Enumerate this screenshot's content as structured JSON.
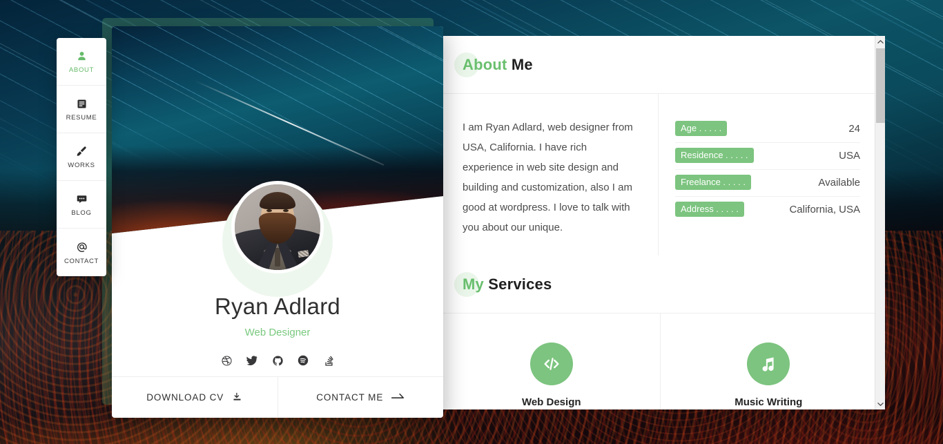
{
  "sidebar": {
    "items": [
      {
        "label": "ABOUT",
        "icon": "person-icon",
        "active": true
      },
      {
        "label": "RESUME",
        "icon": "document-icon",
        "active": false
      },
      {
        "label": "WORKS",
        "icon": "brush-icon",
        "active": false
      },
      {
        "label": "BLOG",
        "icon": "comment-icon",
        "active": false
      },
      {
        "label": "CONTACT",
        "icon": "at-icon",
        "active": false
      }
    ]
  },
  "profile": {
    "name": "Ryan Adlard",
    "role": "Web Designer",
    "socials": [
      {
        "name": "dribbble-icon"
      },
      {
        "name": "twitter-icon"
      },
      {
        "name": "github-icon"
      },
      {
        "name": "spotify-icon"
      },
      {
        "name": "stack-overflow-icon"
      }
    ],
    "actions": [
      {
        "label": "DOWNLOAD CV",
        "icon": "download-icon"
      },
      {
        "label": "CONTACT ME",
        "icon": "arrow-right-icon"
      }
    ]
  },
  "about": {
    "heading_accent": "About",
    "heading_rest": " Me",
    "text": "I am Ryan Adlard, web designer from USA, California. I have rich experience in web site design and building and customization, also I am good at wordpress. I love to talk with you about our unique.",
    "info": [
      {
        "key": "Age . . . . .",
        "value": "24"
      },
      {
        "key": "Residence . . . . .",
        "value": "USA"
      },
      {
        "key": "Freelance . . . . .",
        "value": "Available"
      },
      {
        "key": "Address . . . . .",
        "value": "California, USA"
      }
    ]
  },
  "services": {
    "heading_accent": "My",
    "heading_rest": " Services",
    "items": [
      {
        "icon": "code-icon",
        "title": "Web Design"
      },
      {
        "icon": "music-icon",
        "title": "Music Writing"
      }
    ]
  },
  "colors": {
    "accent": "#6abf6e",
    "accent_fill": "#7cc47f",
    "accent_soft": "#eaf6ea",
    "text_dark": "#1f1f1f",
    "text_body": "#4c4c4c"
  }
}
